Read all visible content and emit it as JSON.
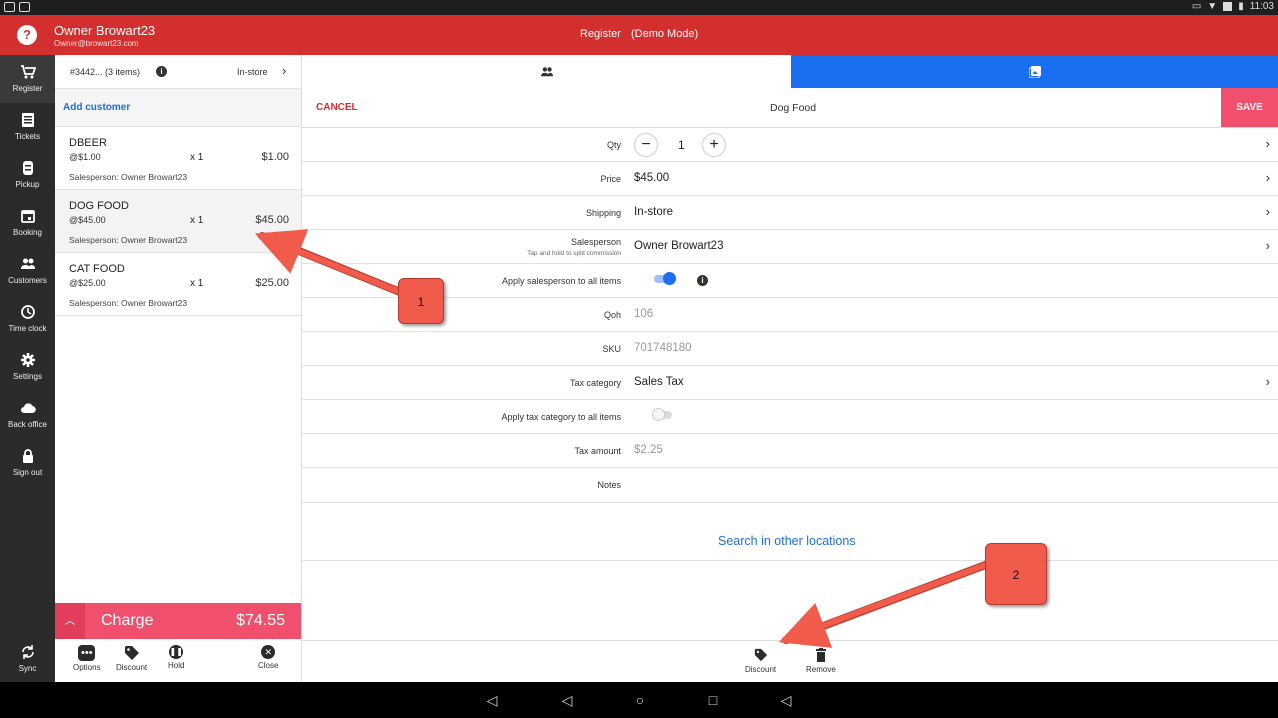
{
  "status_bar": {
    "time": "11:03"
  },
  "header": {
    "help_icon": "question-icon",
    "owner_name": "Owner Browart23",
    "owner_email": "Owner@browart23.com",
    "title": "Register",
    "mode": "(Demo Mode)",
    "color": "#d32f2f"
  },
  "rail": {
    "items": [
      {
        "label": "Register",
        "icon": "cart-icon"
      },
      {
        "label": "Tickets",
        "icon": "receipt-icon"
      },
      {
        "label": "Pickup",
        "icon": "pickup-icon"
      },
      {
        "label": "Booking",
        "icon": "calendar-icon"
      },
      {
        "label": "Customers",
        "icon": "people-icon"
      },
      {
        "label": "Time clock",
        "icon": "clock-icon"
      },
      {
        "label": "Settings",
        "icon": "gear-icon"
      },
      {
        "label": "Back office",
        "icon": "cloud-icon"
      },
      {
        "label": "Sign out",
        "icon": "lock-icon"
      }
    ],
    "sync_label": "Sync"
  },
  "cart": {
    "order_label": "#3442... (3 items)",
    "fulfillment": "In-store",
    "add_customer": "Add customer",
    "items": [
      {
        "name": "DBEER",
        "each": "@$1.00",
        "qty": "x  1",
        "total": "$1.00",
        "salesperson": "Salesperson: Owner Browart23"
      },
      {
        "name": "DOG FOOD",
        "each": "@$45.00",
        "qty": "x  1",
        "total": "$45.00",
        "salesperson": "Salesperson: Owner Browart23"
      },
      {
        "name": "CAT FOOD",
        "each": "@$25.00",
        "qty": "x  1",
        "total": "$25.00",
        "salesperson": "Salesperson: Owner Browart23"
      }
    ],
    "charge_label": "Charge",
    "charge_total": "$74.55",
    "actions": {
      "options": "Options",
      "discount": "Discount",
      "hold": "Hold",
      "close": "Close"
    }
  },
  "editor": {
    "cancel": "CANCEL",
    "item_title": "Dog Food",
    "save": "SAVE",
    "qty_label": "Qty",
    "qty_value": "1",
    "price_label": "Price",
    "price_value": "$45.00",
    "shipping_label": "Shipping",
    "shipping_value": "In-store",
    "salesperson_label": "Salesperson",
    "salesperson_sub": "Tap and hold to split commission",
    "salesperson_value": "Owner Browart23",
    "apply_salesperson_label": "Apply salesperson to all items",
    "apply_salesperson_on": true,
    "qoh_label": "Qoh",
    "qoh_value": "106",
    "sku_label": "SKU",
    "sku_value": "701748180",
    "tax_category_label": "Tax category",
    "tax_category_value": "Sales Tax",
    "apply_tax_label": "Apply tax category to all items",
    "apply_tax_on": false,
    "tax_amount_label": "Tax amount",
    "tax_amount_value": "$2.25",
    "notes_label": "Notes",
    "search_other": "Search in other locations",
    "actions": {
      "discount": "Discount",
      "remove": "Remove"
    }
  },
  "annotations": {
    "callout_1": "1",
    "callout_2": "2"
  },
  "colors": {
    "accent_blue": "#1a6ff0",
    "charge_pink": "#f0506e",
    "annotation": "#f15b4b"
  }
}
